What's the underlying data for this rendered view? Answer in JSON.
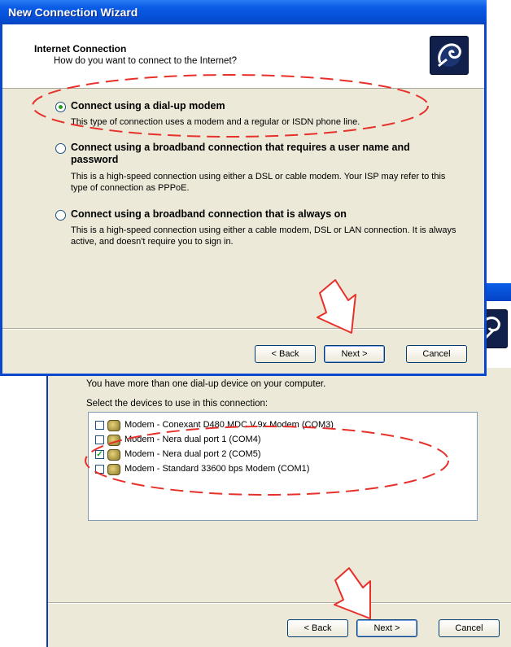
{
  "window2": {
    "intro": "You have more than one dial-up device on your computer.",
    "select_label": "Select the devices to use in this connection:",
    "devices": [
      {
        "label": "Modem - Conexant D480 MDC V.9x Modem (COM3)",
        "checked": false
      },
      {
        "label": "Modem - Nera dual port 1 (COM4)",
        "checked": false
      },
      {
        "label": "Modem - Nera dual port 2 (COM5)",
        "checked": true
      },
      {
        "label": "Modem - Standard 33600 bps Modem (COM1)",
        "checked": false
      }
    ],
    "buttons": {
      "back": "< Back",
      "next": "Next >",
      "cancel": "Cancel"
    }
  },
  "window1": {
    "title": "New Connection Wizard",
    "header_title": "Internet Connection",
    "header_subtitle": "How do you want to connect to the Internet?",
    "options": [
      {
        "title": "Connect using a dial-up modem",
        "description": "This type of connection uses a modem and a regular or ISDN phone line.",
        "selected": true
      },
      {
        "title": "Connect using a broadband connection that requires a user name and password",
        "description": "This is a high-speed connection using either a DSL or cable modem. Your ISP may refer to this type of connection as PPPoE.",
        "selected": false
      },
      {
        "title": "Connect using a broadband connection that is always on",
        "description": "This is a high-speed connection using either a cable modem, DSL or LAN connection. It is always active, and doesn't require you to sign in.",
        "selected": false
      }
    ],
    "buttons": {
      "back": "< Back",
      "next": "Next >",
      "cancel": "Cancel"
    }
  },
  "colors": {
    "title_blue": "#0550d8",
    "annotation_red": "#e8302a",
    "dialog_bg": "#ece9d8"
  },
  "icons": [
    "wizard-connection-icon",
    "modem-icon"
  ]
}
